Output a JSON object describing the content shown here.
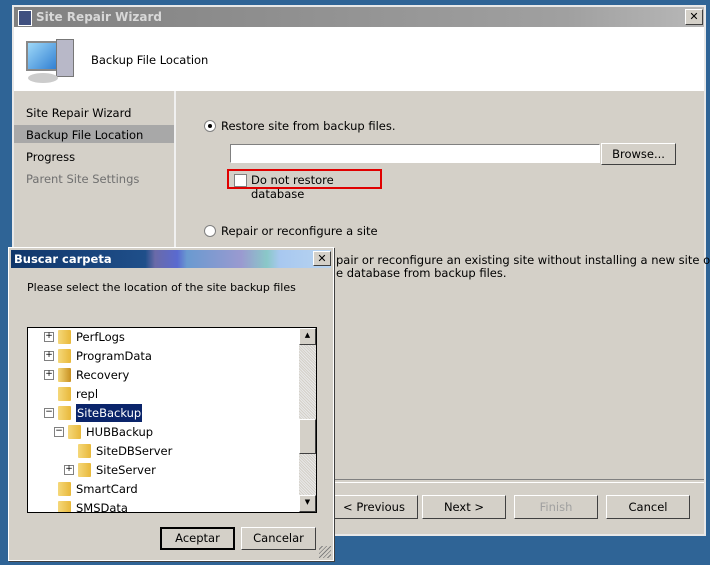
{
  "window": {
    "title": "Site Repair Wizard",
    "header_title": "Backup File Location"
  },
  "nav": {
    "items": [
      {
        "label": "Site Repair Wizard",
        "state": "normal"
      },
      {
        "label": "Backup File Location",
        "state": "selected"
      },
      {
        "label": "Progress",
        "state": "normal"
      },
      {
        "label": "Parent Site Settings",
        "state": "disabled"
      }
    ]
  },
  "main": {
    "restore_option": {
      "label": "Restore site from backup files.",
      "checked": true
    },
    "path_input": {
      "value": ""
    },
    "browse_label": "Browse...",
    "no_restore_db": {
      "label": "Do not restore database",
      "checked": false,
      "highlight_color": "#e00000"
    },
    "repair_option": {
      "label": "Repair or reconfigure a site",
      "checked": false
    },
    "repair_desc_line1": "pair or reconfigure an existing site without installing a new site or",
    "repair_desc_line2": "e database from backup files."
  },
  "footer": {
    "previous": "< Previous",
    "next": "Next >",
    "finish": "Finish",
    "cancel": "Cancel"
  },
  "dialog": {
    "title": "Buscar carpeta",
    "prompt": "Please select the location of the site backup files",
    "tree": [
      {
        "label": "PerfLogs",
        "level": 0,
        "expander": "+"
      },
      {
        "label": "ProgramData",
        "level": 0,
        "expander": "+"
      },
      {
        "label": "Recovery",
        "level": 0,
        "expander": "+",
        "locked": true
      },
      {
        "label": "repl",
        "level": 0,
        "expander": ""
      },
      {
        "label": "SiteBackup",
        "level": 0,
        "expander": "-",
        "selected": true
      },
      {
        "label": "HUBBackup",
        "level": 1,
        "expander": "-"
      },
      {
        "label": "SiteDBServer",
        "level": 2,
        "expander": ""
      },
      {
        "label": "SiteServer",
        "level": 2,
        "expander": "+"
      },
      {
        "label": "SmartCard",
        "level": 0,
        "expander": ""
      },
      {
        "label": "SMSData",
        "level": 0,
        "expander": ""
      }
    ],
    "ok": "Aceptar",
    "cancel": "Cancelar"
  }
}
